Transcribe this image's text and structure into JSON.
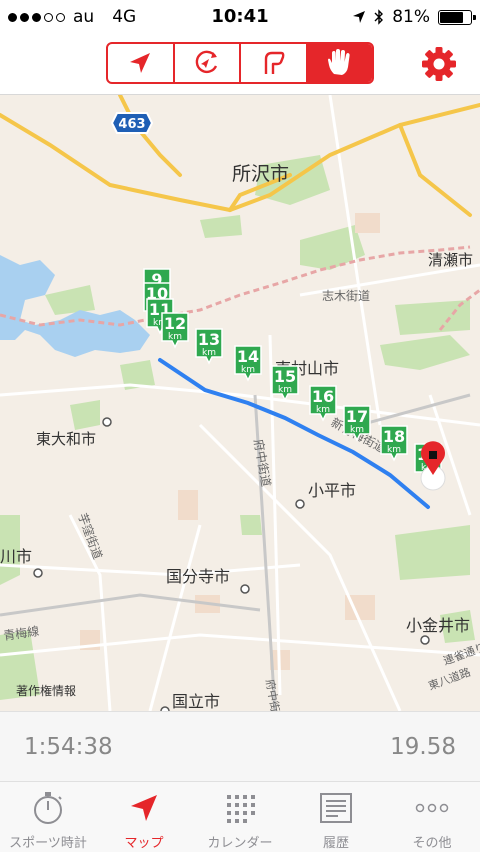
{
  "status": {
    "carrier": "au",
    "network": "4G",
    "time": "10:41",
    "battery": "81%",
    "battery_level": 0.81
  },
  "toolbar": {
    "buttons": [
      "navigation-arrow-icon",
      "compass-icon",
      "route-icon",
      "hand-stop-icon"
    ],
    "selected_index": 3
  },
  "map": {
    "route_shield": "463",
    "places": [
      {
        "name": "所沢市"
      },
      {
        "name": "清瀬市"
      },
      {
        "name": "志木街道"
      },
      {
        "name": "東村山市"
      },
      {
        "name": "新青梅街道"
      },
      {
        "name": "東大和市"
      },
      {
        "name": "小平市"
      },
      {
        "name": "府中街道"
      },
      {
        "name": "芋窪街道"
      },
      {
        "name": "川市"
      },
      {
        "name": "国分寺市"
      },
      {
        "name": "小金井市"
      },
      {
        "name": "青梅線"
      },
      {
        "name": "連雀通り"
      },
      {
        "name": "東八道路"
      },
      {
        "name": "国立市"
      },
      {
        "name": "府中街"
      }
    ],
    "credit": "著作権情報",
    "km_markers": [
      {
        "n": "9"
      },
      {
        "n": "10"
      },
      {
        "n": "11"
      },
      {
        "n": "12"
      },
      {
        "n": "13"
      },
      {
        "n": "14"
      },
      {
        "n": "15"
      },
      {
        "n": "16"
      },
      {
        "n": "17"
      },
      {
        "n": "18"
      },
      {
        "n": "19"
      }
    ],
    "km_unit": "km"
  },
  "info": {
    "elapsed": "1:54:38",
    "distance": "19.58"
  },
  "tabs": [
    {
      "label": "スポーツ時計",
      "icon": "stopwatch-icon"
    },
    {
      "label": "マップ",
      "icon": "location-arrow-icon"
    },
    {
      "label": "カレンダー",
      "icon": "calendar-grid-icon"
    },
    {
      "label": "履歴",
      "icon": "history-list-icon"
    },
    {
      "label": "その他",
      "icon": "more-dots-icon"
    }
  ],
  "colors": {
    "accent": "#e5262a",
    "route": "#2f80f0",
    "marker": "#2fa84f"
  }
}
